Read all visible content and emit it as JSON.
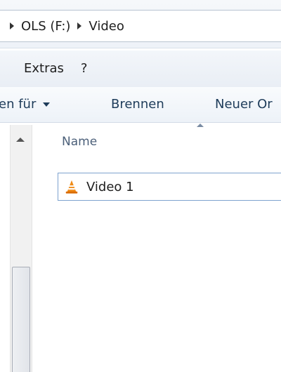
{
  "address": {
    "drive": "OLS (F:)",
    "folder": "Video"
  },
  "menu": {
    "items": [
      "Extras",
      "?"
    ]
  },
  "toolbar": {
    "open_with_label": "en für",
    "burn_label": "Brennen",
    "new_folder_label": "Neuer Or"
  },
  "file_list": {
    "column_header": "Name",
    "files": [
      {
        "name": "Video 1",
        "icon": "vlc-icon"
      }
    ]
  },
  "colors": {
    "selection_border": "#7da2ce",
    "toolbar_text": "#1e3c5a",
    "header_text": "#4c607a",
    "vlc_orange": "#f08b17"
  }
}
